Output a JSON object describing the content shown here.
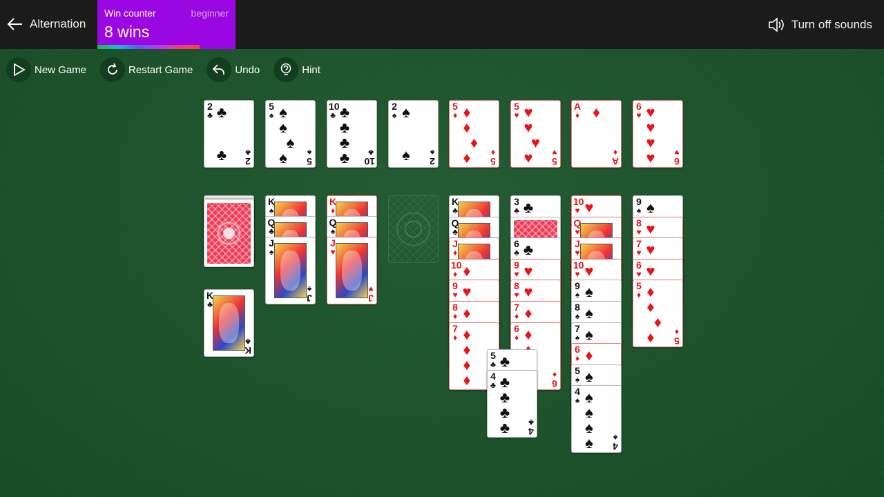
{
  "header": {
    "back_label": "Alternation",
    "win_counter": {
      "title": "Win counter",
      "level": "beginner",
      "count": "8 wins",
      "progress": 0.74
    },
    "sound_label": "Turn off sounds"
  },
  "toolbar": {
    "new_game": "New Game",
    "restart_game": "Restart Game",
    "undo": "Undo",
    "hint": "Hint"
  },
  "colors": {
    "felt": "#1d5a2e",
    "topbar": "#1b1b1b",
    "win_counter": "#9b07e2"
  },
  "foundations": [
    {
      "rank": "2",
      "suit": "♣",
      "color": "black"
    },
    {
      "rank": "5",
      "suit": "♠",
      "color": "black"
    },
    {
      "rank": "10",
      "suit": "♣",
      "color": "black"
    },
    {
      "rank": "2",
      "suit": "♠",
      "color": "black"
    },
    {
      "rank": "5",
      "suit": "♦",
      "color": "red"
    },
    {
      "rank": "5",
      "suit": "♥",
      "color": "red"
    },
    {
      "rank": "A",
      "suit": "♦",
      "color": "red"
    },
    {
      "rank": "6",
      "suit": "♥",
      "color": "red"
    }
  ],
  "stock": {
    "waste_card": {
      "rank": "K",
      "suit": "♣",
      "color": "black"
    }
  },
  "tableau": [
    [
      {
        "rank": "K",
        "suit": "♠",
        "color": "black"
      },
      {
        "rank": "Q",
        "suit": "♣",
        "color": "black"
      },
      {
        "rank": "J",
        "suit": "♠",
        "color": "black"
      }
    ],
    [
      {
        "rank": "K",
        "suit": "♦",
        "color": "red"
      },
      {
        "rank": "Q",
        "suit": "♠",
        "color": "black"
      },
      {
        "rank": "J",
        "suit": "♥",
        "color": "red"
      }
    ],
    [],
    [
      {
        "rank": "K",
        "suit": "♣",
        "color": "black"
      },
      {
        "rank": "Q",
        "suit": "♣",
        "color": "black"
      },
      {
        "rank": "J",
        "suit": "♦",
        "color": "red"
      },
      {
        "rank": "10",
        "suit": "♦",
        "color": "red"
      },
      {
        "rank": "9",
        "suit": "♥",
        "color": "red"
      },
      {
        "rank": "8",
        "suit": "♦",
        "color": "red"
      },
      {
        "rank": "7",
        "suit": "♦",
        "color": "red"
      }
    ],
    [
      {
        "rank": "3",
        "suit": "♣",
        "color": "black"
      },
      {
        "rank": "",
        "suit": "",
        "color": "back"
      },
      {
        "rank": "6",
        "suit": "♣",
        "color": "black"
      },
      {
        "rank": "9",
        "suit": "♥",
        "color": "red"
      },
      {
        "rank": "8",
        "suit": "♥",
        "color": "red"
      },
      {
        "rank": "7",
        "suit": "♦",
        "color": "red"
      },
      {
        "rank": "6",
        "suit": "♦",
        "color": "red"
      }
    ],
    [
      {
        "rank": "10",
        "suit": "♥",
        "color": "red"
      },
      {
        "rank": "Q",
        "suit": "♥",
        "color": "red"
      },
      {
        "rank": "J",
        "suit": "♥",
        "color": "red"
      },
      {
        "rank": "10",
        "suit": "♥",
        "color": "red"
      },
      {
        "rank": "9",
        "suit": "♠",
        "color": "black"
      },
      {
        "rank": "8",
        "suit": "♠",
        "color": "black"
      },
      {
        "rank": "7",
        "suit": "♠",
        "color": "black"
      },
      {
        "rank": "6",
        "suit": "♦",
        "color": "red"
      },
      {
        "rank": "5",
        "suit": "♠",
        "color": "black"
      },
      {
        "rank": "4",
        "suit": "♠",
        "color": "black"
      }
    ],
    [
      {
        "rank": "9",
        "suit": "♠",
        "color": "black"
      },
      {
        "rank": "8",
        "suit": "♥",
        "color": "red"
      },
      {
        "rank": "7",
        "suit": "♥",
        "color": "red"
      },
      {
        "rank": "6",
        "suit": "♥",
        "color": "red"
      },
      {
        "rank": "5",
        "suit": "♦",
        "color": "red"
      }
    ]
  ],
  "dragging": [
    {
      "rank": "5",
      "suit": "♣",
      "color": "black"
    },
    {
      "rank": "4",
      "suit": "♣",
      "color": "black"
    }
  ]
}
